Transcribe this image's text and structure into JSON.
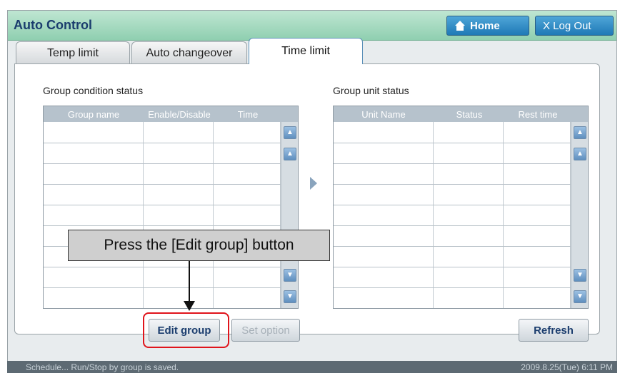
{
  "window": {
    "title": "Auto Control"
  },
  "header": {
    "home_label": "Home",
    "logout_label": "X Log Out"
  },
  "tabs": [
    {
      "label": "Temp limit"
    },
    {
      "label": "Auto changeover"
    },
    {
      "label": "Time limit",
      "active": true
    }
  ],
  "group_condition": {
    "title": "Group condition status",
    "columns": [
      "Group name",
      "Enable/Disable",
      "Time"
    ],
    "row_count": 9
  },
  "group_unit": {
    "title": "Group unit status",
    "columns": [
      "Unit Name",
      "Status",
      "Rest time"
    ],
    "row_count": 9
  },
  "buttons": {
    "edit_group": "Edit group",
    "set_option": "Set option",
    "refresh": "Refresh"
  },
  "callout": {
    "text": "Press the [Edit group] button"
  },
  "statusbar": {
    "message": "Schedule... Run/Stop by group is saved.",
    "datetime": "2009.8.25(Tue)  6:11 PM"
  },
  "icons": {
    "home": "home-icon",
    "scroll_top": "double-up-icon",
    "scroll_up": "up-icon",
    "scroll_down": "down-icon",
    "scroll_bottom": "double-down-icon",
    "transfer": "arrow-right-icon"
  },
  "colors": {
    "titlebar": "#9fd7bb",
    "title_text": "#1b3d6e",
    "header_button": "#2a8bc7",
    "table_header": "#b6c2cc",
    "highlight": "#e0141b"
  }
}
